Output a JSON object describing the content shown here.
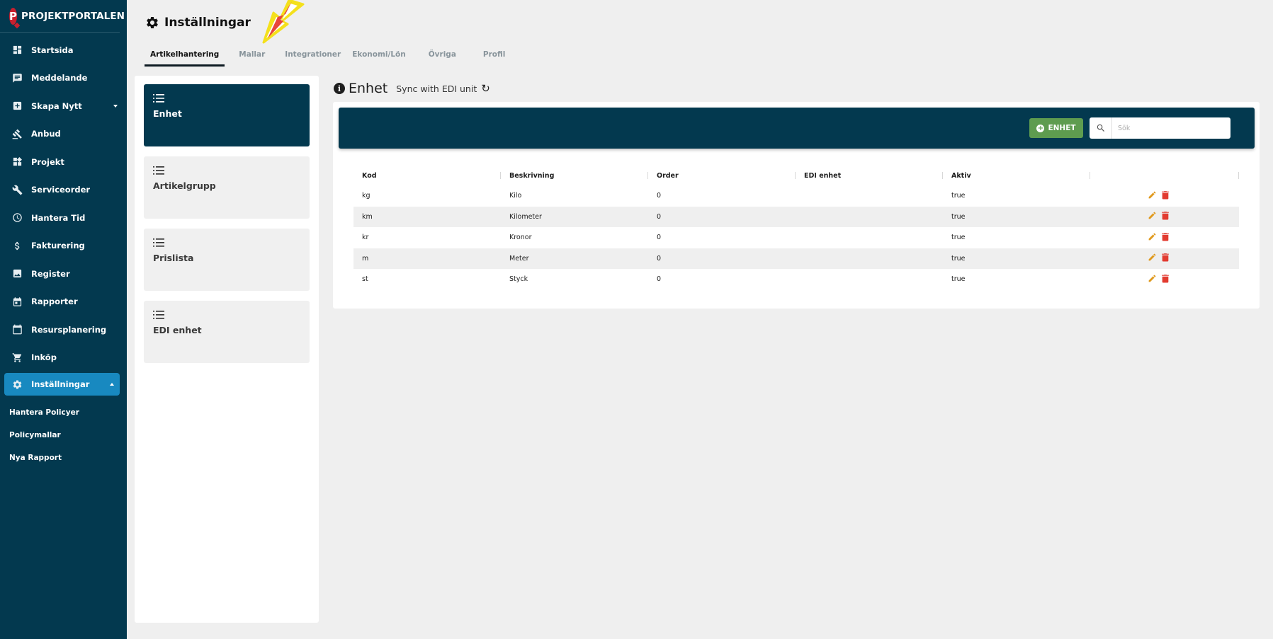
{
  "app": {
    "brand": "PROJEKTPORTALEN",
    "logo_letter": "P"
  },
  "sidebar": {
    "items": [
      {
        "label": "Startsida",
        "icon": "dashboard-icon"
      },
      {
        "label": "Meddelande",
        "icon": "message-icon"
      },
      {
        "label": "Skapa Nytt",
        "icon": "add-box-icon",
        "has_caret": true
      },
      {
        "label": "Anbud",
        "icon": "gavel-icon"
      },
      {
        "label": "Projekt",
        "icon": "widgets-icon"
      },
      {
        "label": "Serviceorder",
        "icon": "wrench-icon"
      },
      {
        "label": "Hantera Tid",
        "icon": "clock-icon"
      },
      {
        "label": "Fakturering",
        "icon": "dollar-icon"
      },
      {
        "label": "Register",
        "icon": "image-icon"
      },
      {
        "label": "Rapporter",
        "icon": "calendar-icon"
      },
      {
        "label": "Resursplanering",
        "icon": "calendar-blank-icon"
      },
      {
        "label": "Inköp",
        "icon": "cart-icon"
      },
      {
        "label": "Inställningar",
        "icon": "gear-icon",
        "active": true,
        "has_caret": true
      }
    ],
    "subitems": [
      "Hantera Policyer",
      "Policymallar",
      "Nya Rapport"
    ]
  },
  "header": {
    "title": "Inställningar"
  },
  "tabs": [
    {
      "label": "Artikelhantering",
      "active": true
    },
    {
      "label": "Mallar"
    },
    {
      "label": "Integrationer"
    },
    {
      "label": "Ekonomi/Lön"
    },
    {
      "label": "Övriga"
    },
    {
      "label": "Profil"
    }
  ],
  "categories": [
    {
      "label": "Enhet",
      "active": true
    },
    {
      "label": "Artikelgrupp"
    },
    {
      "label": "Prislista"
    },
    {
      "label": "EDI enhet"
    }
  ],
  "section": {
    "info_glyph": "i",
    "title": "Enhet",
    "sync_text": "Sync with EDI unit"
  },
  "toolbar": {
    "add_label": "ENHET",
    "search_placeholder": "Sök"
  },
  "table": {
    "headers": [
      "Kod",
      "Beskrivning",
      "Order",
      "EDI enhet",
      "Aktiv",
      ""
    ],
    "rows": [
      {
        "kod": "kg",
        "beskrivning": "Kilo",
        "order": "0",
        "edi": "",
        "aktiv": "true"
      },
      {
        "kod": "km",
        "beskrivning": "Kilometer",
        "order": "0",
        "edi": "",
        "aktiv": "true"
      },
      {
        "kod": "kr",
        "beskrivning": "Kronor",
        "order": "0",
        "edi": "",
        "aktiv": "true"
      },
      {
        "kod": "m",
        "beskrivning": "Meter",
        "order": "0",
        "edi": "",
        "aktiv": "true"
      },
      {
        "kod": "st",
        "beskrivning": "Styck",
        "order": "0",
        "edi": "",
        "aktiv": "true"
      }
    ]
  },
  "colors": {
    "sidebar_bg": "#03394f",
    "active_nav": "#1889c0",
    "add_button": "#5e9c4f",
    "edit_icon": "#e09a1f",
    "delete_icon": "#e23b30",
    "annotation_arrow": "#f4e01c"
  }
}
